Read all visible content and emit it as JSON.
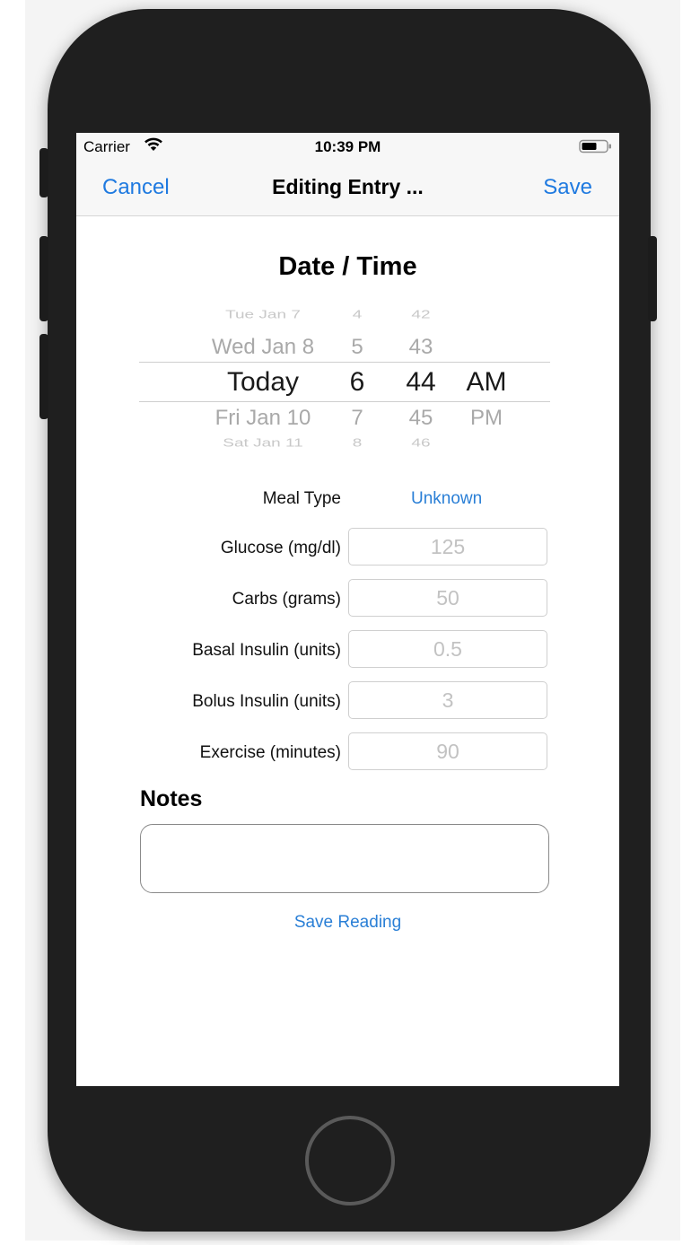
{
  "status_bar": {
    "carrier": "Carrier",
    "time": "10:39 PM"
  },
  "nav": {
    "cancel": "Cancel",
    "title": "Editing Entry ...",
    "save": "Save"
  },
  "date_time": {
    "title": "Date / Time",
    "days": [
      "Tue Jan 7",
      "Wed Jan 8",
      "Today",
      "Fri Jan 10",
      "Sat Jan 11"
    ],
    "hours": [
      "4",
      "5",
      "6",
      "7",
      "8"
    ],
    "minutes": [
      "42",
      "43",
      "44",
      "45",
      "46"
    ],
    "meridiem": [
      "AM",
      "PM"
    ]
  },
  "form": {
    "meal_type": {
      "label": "Meal Type",
      "value": "Unknown"
    },
    "glucose": {
      "label": "Glucose (mg/dl)",
      "placeholder": "125"
    },
    "carbs": {
      "label": "Carbs (grams)",
      "placeholder": "50"
    },
    "basal": {
      "label": "Basal Insulin (units)",
      "placeholder": "0.5"
    },
    "bolus": {
      "label": "Bolus Insulin (units)",
      "placeholder": "3"
    },
    "exercise": {
      "label": "Exercise (minutes)",
      "placeholder": "90"
    },
    "notes_title": "Notes",
    "save_reading": "Save Reading"
  },
  "colors": {
    "accent": "#1f7ae0",
    "link": "#2a7fd6",
    "device": "#1f1f1f"
  },
  "icons": [
    "wifi-icon",
    "battery-icon"
  ]
}
